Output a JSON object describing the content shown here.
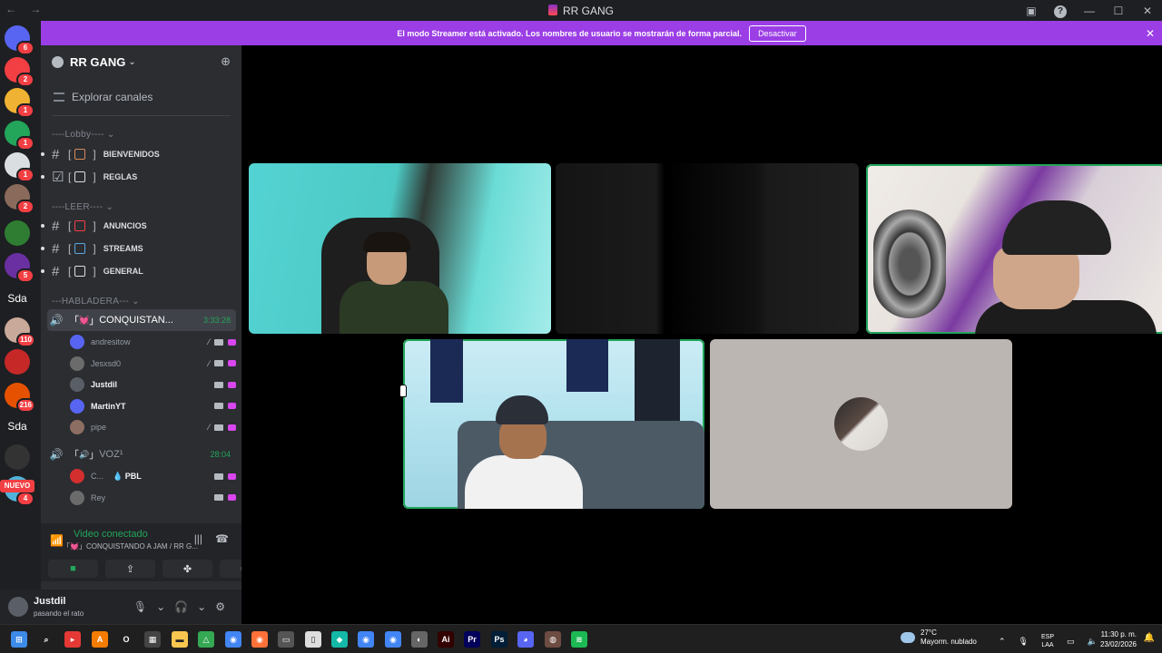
{
  "window": {
    "title": "RR GANG",
    "nav": "← →",
    "help": "?",
    "minimize": "—",
    "maximize": "☐",
    "close": "✕"
  },
  "banner": {
    "text": "El modo Streamer está activado. Los nombres de usuario se mostrarán de forma parcial.",
    "button": "Desactivar",
    "close": "✕"
  },
  "servers": [
    {
      "badge": "6",
      "color": "#5865f2",
      "icon": "discord-home-icon"
    },
    {
      "badge": "2",
      "color": "#f23f43",
      "icon": "friends-icon"
    },
    {
      "badge": "1",
      "color": "#f0b232",
      "icon": "user-icon"
    },
    {
      "badge": "1",
      "color": "#23a55a",
      "icon": "user-icon"
    },
    {
      "badge": "1",
      "color": "#dbdee1",
      "icon": "server-icon"
    },
    {
      "badge": "2",
      "color": "#8a6a5a",
      "icon": "server-icon"
    },
    {
      "badge": "",
      "color": "#2e7d32",
      "icon": "server-icon"
    },
    {
      "badge": "5",
      "color": "#6a2fa0",
      "icon": "server-icon"
    },
    {
      "label": "Sda"
    },
    {
      "badge": "110",
      "color": "#c9a99a",
      "icon": "server-icon"
    },
    {
      "badge": "",
      "color": "#c62828",
      "icon": "server-icon"
    },
    {
      "badge": "216",
      "color": "#e65100",
      "icon": "server-icon"
    },
    {
      "label": "Sda"
    },
    {
      "badge": "",
      "color": "#333",
      "icon": "server-icon"
    },
    {
      "badge": "4",
      "color": "#4fb3d9",
      "icon": "server-icon"
    }
  ],
  "nuevo": "NUEVO",
  "guild": {
    "name": "RR GANG",
    "chevron": "⌄",
    "explore": "Explorar canales"
  },
  "categories": {
    "lobby": "----Lobby---- ⌄",
    "leer": "----LEER---- ⌄",
    "habladera": "---HABLADERA--- ⌄"
  },
  "channels": [
    {
      "name": "BIENVENIDOS",
      "icon": "#",
      "emoji_color": "#d68a5a"
    },
    {
      "name": "REGLAS",
      "icon": "☑",
      "emoji_color": "#dbdee1"
    },
    {
      "name": "ANUNCIOS",
      "icon": "#",
      "emoji_color": "#f23f43"
    },
    {
      "name": "STREAMS",
      "icon": "#",
      "emoji_color": "#5aa7e0"
    },
    {
      "name": "GENERAL",
      "icon": "#",
      "emoji_color": "#dbdee1"
    }
  ],
  "voice_channels": [
    {
      "name": "CONQUISTAN...",
      "timer": "3:33:28",
      "emoji": "💓"
    },
    {
      "name": "VOZ¹",
      "timer": "28:04",
      "emoji": "🔊"
    }
  ],
  "voice_users_1": [
    {
      "name": "andresitow",
      "bright": false,
      "muted": true,
      "avatar": "#5865f2"
    },
    {
      "name": "Jesxsd0",
      "bright": false,
      "muted": true,
      "avatar": "#6b6b6b"
    },
    {
      "name": "Justdil",
      "bright": true,
      "muted": false,
      "avatar": "#5a5e66"
    },
    {
      "name": "MartinYT",
      "bright": true,
      "muted": false,
      "avatar": "#5865f2"
    },
    {
      "name": "pipe",
      "bright": false,
      "muted": true,
      "avatar": "#8d6e63"
    }
  ],
  "voice_users_2": [
    {
      "name": "C...",
      "extra": "PBL",
      "bright": false,
      "avatar": "#d32f2f"
    },
    {
      "name": "Rey",
      "extra": "",
      "bright": false,
      "avatar": "#6b6b6b"
    }
  ],
  "voice_panel": {
    "status": "Video conectado",
    "channel": "「💓」CONQUISTANDO A JAM / RR G..."
  },
  "user_panel": {
    "name": "Justdil",
    "status": "pasando el rato"
  },
  "taskbar": {
    "weather_temp": "27°C",
    "weather_desc": "Mayorm. nublado",
    "lang_top": "ESP",
    "lang_bottom": "LAA",
    "time": "11:30 p. m.",
    "date": "23/02/2026"
  },
  "colors": {
    "accent": "#9b3ee6",
    "speaking": "#23a55a",
    "sidebar": "#2b2d31",
    "rail": "#1e1f22"
  }
}
